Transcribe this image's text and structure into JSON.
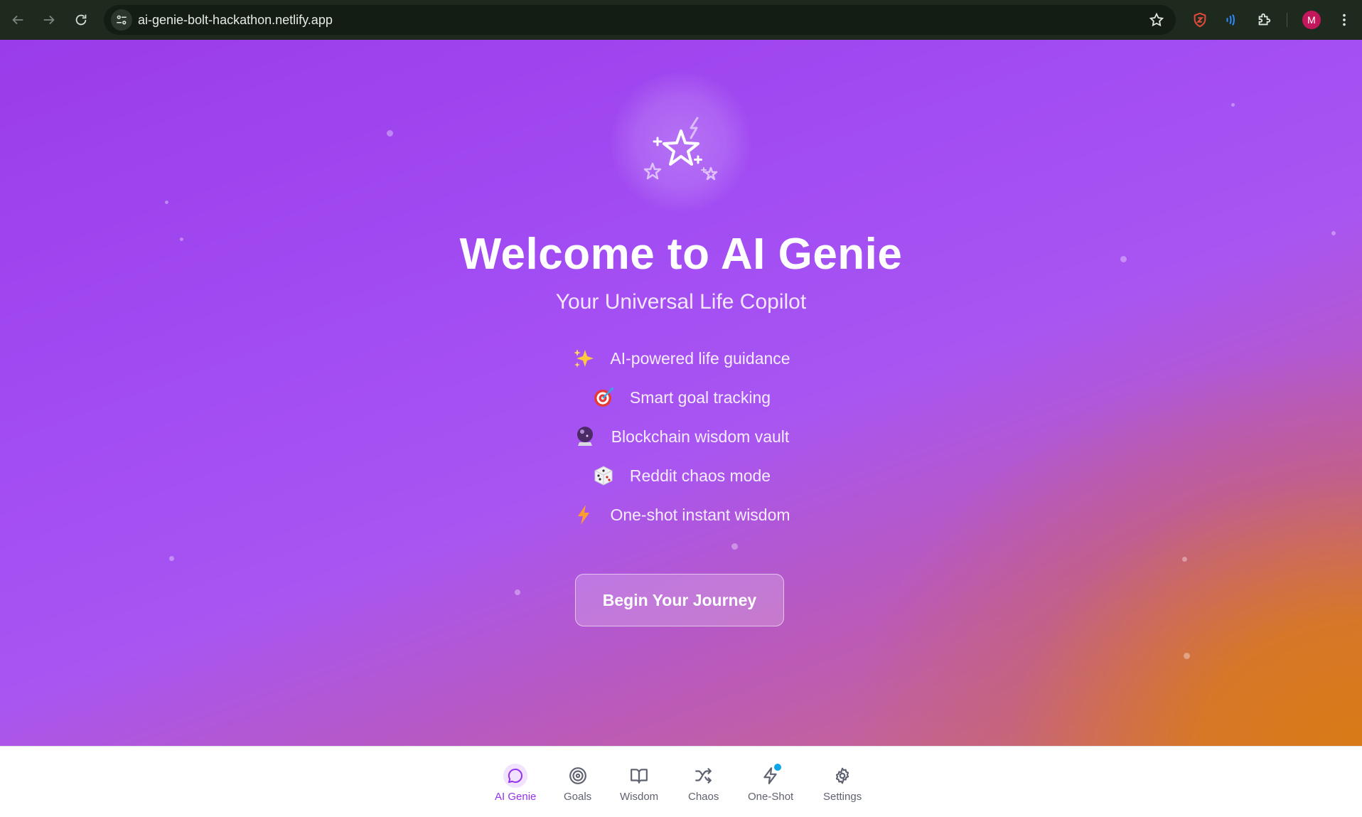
{
  "browser": {
    "url": "ai-genie-bolt-hackathon.netlify.app",
    "avatar_letter": "M"
  },
  "hero": {
    "title": "Welcome to AI Genie",
    "subtitle": "Your Universal Life Copilot",
    "features": [
      {
        "emoji": "✨",
        "icon": "sparkles-emoji",
        "label": "AI-powered life guidance"
      },
      {
        "emoji": "🎯",
        "icon": "target-emoji",
        "label": "Smart goal tracking"
      },
      {
        "emoji": "🔮",
        "icon": "crystal-ball-emoji",
        "label": "Blockchain wisdom vault"
      },
      {
        "emoji": "🎲",
        "icon": "dice-emoji",
        "label": "Reddit chaos mode"
      },
      {
        "emoji": "⚡",
        "icon": "lightning-emoji",
        "label": "One-shot instant wisdom"
      }
    ],
    "cta_label": "Begin Your Journey"
  },
  "nav": {
    "items": [
      {
        "label": "AI Genie",
        "icon": "chat-bubble-icon",
        "active": true
      },
      {
        "label": "Goals",
        "icon": "target-icon"
      },
      {
        "label": "Wisdom",
        "icon": "book-open-icon"
      },
      {
        "label": "Chaos",
        "icon": "shuffle-icon"
      },
      {
        "label": "One-Shot",
        "icon": "zap-icon",
        "badge": true
      },
      {
        "label": "Settings",
        "icon": "gear-icon"
      }
    ],
    "active_color": "#9333ea",
    "badge_color": "#0ea5e9"
  }
}
